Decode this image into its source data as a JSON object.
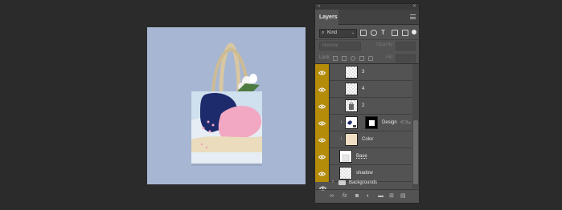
{
  "panel": {
    "collapse_glyph": "«",
    "close_glyph": "✕",
    "tab_label": "Layers",
    "menu_icon": "hamburger-menu-icon",
    "filter": {
      "kind_label": "Kind",
      "icons": [
        "image-filter-icon",
        "adjustment-filter-icon",
        "type-filter-icon",
        "shape-filter-icon",
        "smart-object-filter-icon"
      ]
    },
    "blend_mode": "Normal",
    "opacity_label": "Opacity:",
    "lock_label": "Lock:",
    "fill_label": "Fill:"
  },
  "layers": [
    {
      "name": "3",
      "visible": true
    },
    {
      "name": "4",
      "visible": true
    },
    {
      "name": "2",
      "visible": true
    },
    {
      "name": "Design",
      "visible": true,
      "clipped": true,
      "has_mask": true,
      "smart_object": true
    },
    {
      "name": "Color",
      "visible": true,
      "clipped": true
    },
    {
      "name": "Base",
      "visible": true
    },
    {
      "name": "shadow",
      "visible": true
    }
  ],
  "group": {
    "name": "Backgrounds",
    "visible": true,
    "collapsed": true
  },
  "bottom_icons": [
    "link-layers-icon",
    "fx-icon",
    "add-mask-icon",
    "adjustment-layer-icon",
    "new-group-icon",
    "new-layer-icon",
    "trash-icon"
  ],
  "colors": {
    "canvas_background": "#a7b6d2",
    "visibility_highlight": "#b48c0a",
    "panel_bg": "#535353"
  }
}
